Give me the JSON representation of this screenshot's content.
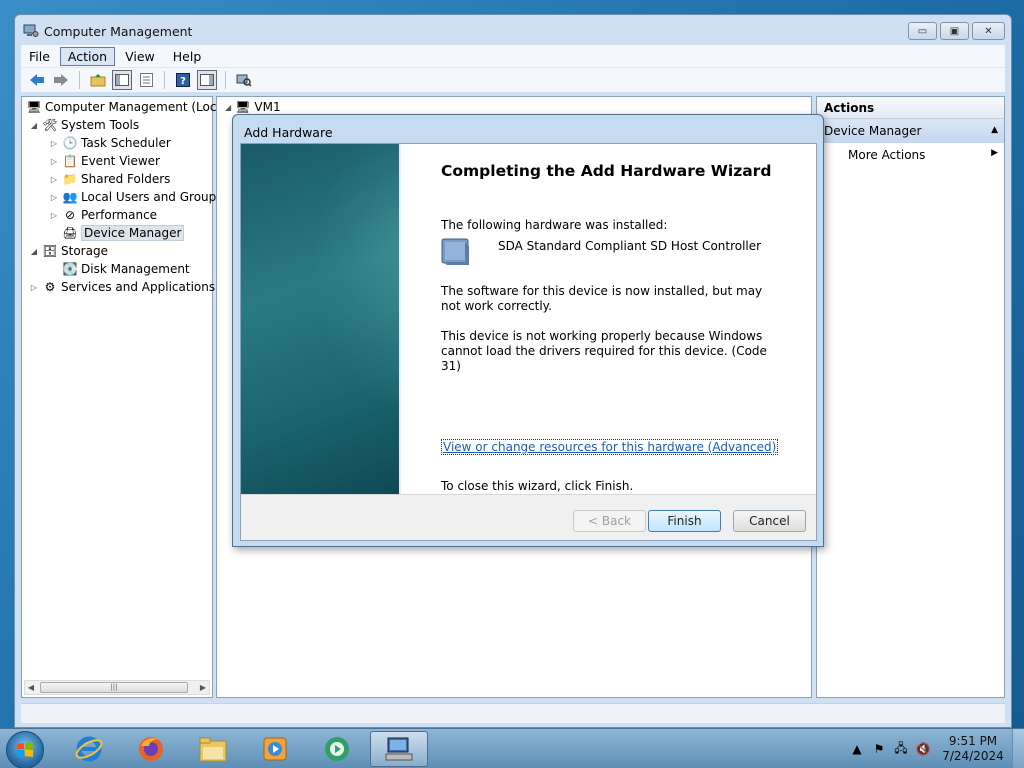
{
  "window": {
    "title": "Computer Management",
    "minimize": "▭",
    "maximize": "▣",
    "close": "✕"
  },
  "menu": [
    "File",
    "Action",
    "View",
    "Help"
  ],
  "tree": {
    "root": "Computer Management (Local",
    "system_tools": "System Tools",
    "task_scheduler": "Task Scheduler",
    "event_viewer": "Event Viewer",
    "shared_folders": "Shared Folders",
    "local_users": "Local Users and Groups",
    "performance": "Performance",
    "device_manager": "Device Manager",
    "storage": "Storage",
    "disk_management": "Disk Management",
    "services": "Services and Applications"
  },
  "middle": {
    "computer": "VM1"
  },
  "actions": {
    "header": "Actions",
    "section": "Device Manager",
    "more": "More Actions"
  },
  "dialog": {
    "title": "Add Hardware",
    "heading": "Completing the Add Hardware Wizard",
    "installed_label": "The following hardware was installed:",
    "device_name": "SDA Standard Compliant SD Host Controller",
    "software_text": "The software for this device is now installed, but may not work correctly.",
    "error_text": "This device is not working properly because Windows cannot load the drivers required for this device. (Code 31)",
    "link": "View or change resources for this hardware (Advanced)",
    "close_text": "To close this wizard, click Finish.",
    "back": "< Back",
    "finish": "Finish",
    "cancel": "Cancel"
  },
  "taskbar": {
    "time": "9:51 PM",
    "date": "7/24/2024"
  },
  "colors": {
    "wizard_side": "#1c6670",
    "link": "#1a5fb4",
    "desktop": "#2a7ab0"
  }
}
